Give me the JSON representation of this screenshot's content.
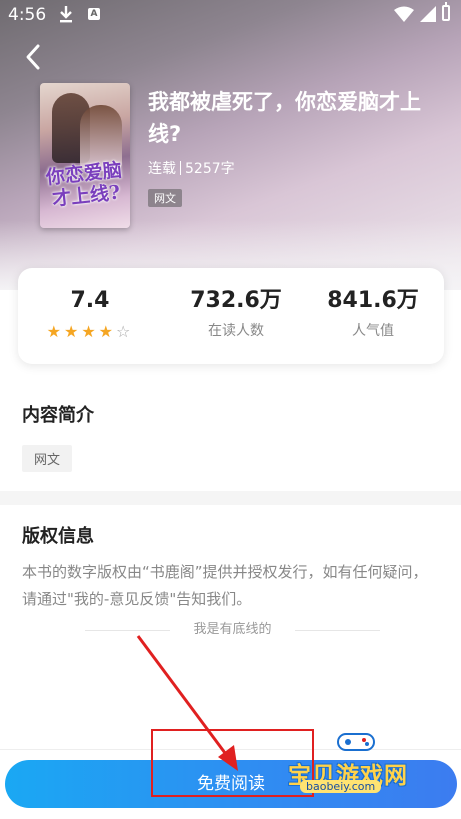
{
  "status_bar": {
    "time": "4:56",
    "a_label": "A"
  },
  "book": {
    "title": "我都被虐死了，你恋爱脑才上线?",
    "status": "连载",
    "word_count": "5257字",
    "tag": "网文",
    "cover_title": "你恋爱脑才上线?"
  },
  "stats": {
    "rating": "7.4",
    "rating_stars": 4,
    "readers_value": "732.6万",
    "readers_label": "在读人数",
    "popularity_value": "841.6万",
    "popularity_label": "人气值"
  },
  "intro": {
    "title": "内容简介",
    "tag": "网文"
  },
  "copyright": {
    "title": "版权信息",
    "text": "本书的数字版权由“书鹿阁”提供并授权发行，如有任何疑问，请通过\"我的-意见反馈\"告知我们。"
  },
  "bottom_line_text": "我是有底线的",
  "read_button_label": "免费阅读",
  "watermark": {
    "text": "宝贝游戏网",
    "url": "baobeiy.com"
  },
  "colors": {
    "accent_gradient_start": "#1aa8f3",
    "accent_gradient_end": "#3c7cf0",
    "star": "#f5a623",
    "annotation_red": "#e02020"
  }
}
